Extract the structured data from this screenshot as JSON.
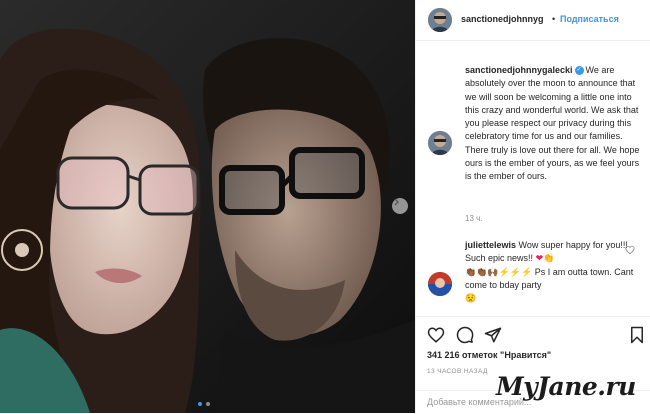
{
  "post": {
    "author": "sanctionedjohnnyg",
    "follow_label": "Подписаться",
    "separator": "•"
  },
  "caption": {
    "username": "sanctionedjohnnygalecki",
    "text": "We are absolutely over the moon to announce that we will soon be welcoming a little one into this crazy and wonderful world. We ask that you please respect our privacy during this celebratory time for us and our families. There truly is love out there for all. We hope ours is the ember of yours, as we feel yours is the ember of ours.",
    "time": "13 ч."
  },
  "comment": {
    "username": "juliettelewis",
    "text_line": "Wow super happy for you!!! Such epic news!!",
    "emoji_line": "👏🏾👏🏾🙌🏾⚡⚡⚡ Ps I am outta town. Cant come to bday party",
    "emoji_tail": "😟"
  },
  "stats": {
    "likes": "341 216 отметок \"Нравится\"",
    "posted_ago": "13 ЧАСОВ НАЗАД"
  },
  "comment_input": {
    "placeholder": "Добавьте комментарий..."
  },
  "watermark": "MyJane.ru",
  "colors": {
    "link_blue": "#3897f0",
    "text": "#262626",
    "muted": "#8e8e8e",
    "heart": "#ed4956"
  },
  "icons": [
    "heart-icon",
    "comment-icon",
    "share-icon",
    "bookmark-icon",
    "verified-icon",
    "chevron-right-icon"
  ]
}
